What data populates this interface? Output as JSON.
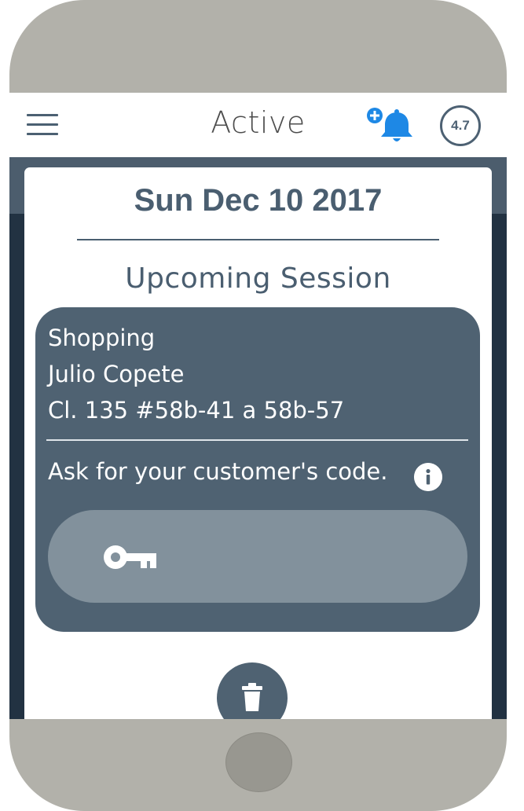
{
  "app_bar": {
    "title": "Active",
    "rating": "4.7",
    "menu_icon": "hamburger-menu-icon",
    "notification_icon": "bell-plus-icon"
  },
  "session": {
    "date": "Sun Dec 10 2017",
    "heading": "Upcoming Session",
    "category": "Shopping",
    "customer_name": "Julio Copete",
    "address": "Cl. 135 #58b-41 a 58b-57",
    "code_prompt": "Ask for your customer's code.",
    "info_icon": "info-icon",
    "code_field_icon": "key-icon",
    "code_value": "",
    "delete_icon": "trash-icon"
  },
  "colors": {
    "accent": "#4a5e70",
    "card_dark": "#4f6272",
    "code_field": "#82919c",
    "device_frame": "#b2b1aa",
    "notification_blue": "#1e88e5"
  }
}
